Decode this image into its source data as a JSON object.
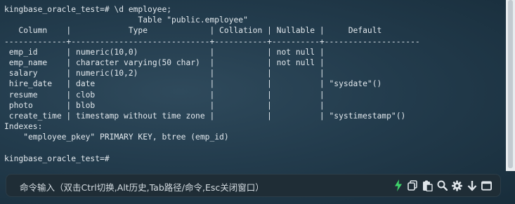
{
  "terminal": {
    "lines": [
      "kingbase_oracle_test=# \\d employee;",
      "                            Table \"public.employee\"",
      "   Column    |            Type             | Collation | Nullable |     Default",
      "-------------+-----------------------------+-----------+----------+--------------------",
      " emp_id      | numeric(10,0)               |           | not null |",
      " emp_name    | character varying(50 char)  |           | not null |",
      " salary      | numeric(10,2)               |           |          |",
      " hire_date   | date                        |           |          | \"sysdate\"()",
      " resume      | clob                        |           |          |",
      " photo       | blob                        |           |          |",
      " create_time | timestamp without time zone |           |          | \"systimestamp\"()",
      "Indexes:",
      "    \"employee_pkey\" PRIMARY KEY, btree (emp_id)",
      "",
      "kingbase_oracle_test=#"
    ]
  },
  "command_bar": {
    "hint": "命令输入（双击Ctrl切换,Alt历史,Tab路径/命令,Esc关闭窗口）",
    "icons": [
      "lightning-icon",
      "copy-icon",
      "paste-icon",
      "search-icon",
      "settings-icon",
      "download-icon",
      "window-icon"
    ]
  },
  "colors": {
    "background": "#233c4d",
    "text": "#e3e9ee",
    "accent_green": "#3fd46b"
  }
}
